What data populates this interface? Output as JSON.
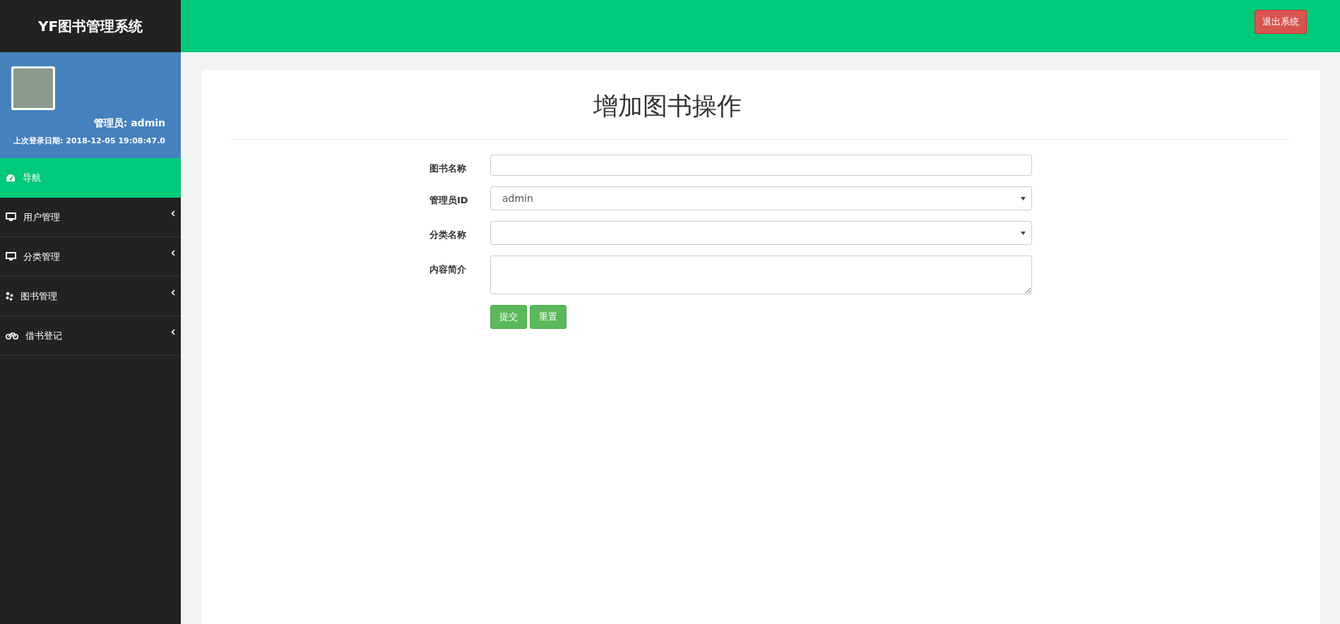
{
  "sidebar": {
    "brand": "YF图书管理系统",
    "user": {
      "role_line": "管理员: admin",
      "last_login": "上次登录日期: 2018-12-05 19:08:47.0"
    },
    "items": [
      {
        "kind": "link",
        "label": "导航",
        "selected": true
      },
      {
        "kind": "submenu",
        "label": "用户管理",
        "selected": false
      },
      {
        "kind": "submenu",
        "label": "分类管理",
        "selected": false
      },
      {
        "kind": "submenu",
        "label": "图书管理",
        "selected": false
      },
      {
        "kind": "submenu",
        "label": "借书登记",
        "selected": false
      }
    ]
  },
  "header": {
    "logout_button": "退出系统"
  },
  "form": {
    "title": "增加图书操作",
    "fields": [
      {
        "kind": "input",
        "label": "图书名称"
      },
      {
        "kind": "select",
        "label": "管理员ID",
        "value": "admin"
      },
      {
        "kind": "select",
        "label": "分类名称"
      },
      {
        "kind": "textarea",
        "label": "内容简介"
      }
    ],
    "buttons": [
      "提交",
      "重置"
    ]
  }
}
